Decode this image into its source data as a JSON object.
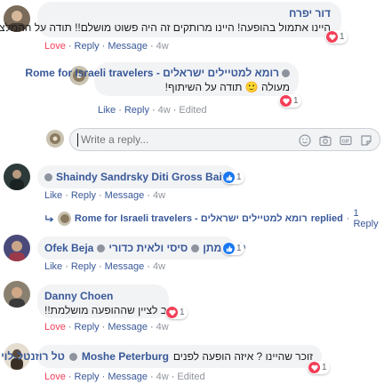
{
  "comments": [
    {
      "author": "דור יפרח",
      "text": "היינו אתמול בהופעה! היינו מרותקים זה היה פשוט מושלם!! תודה על ההמלצה!!",
      "reaction": {
        "type": "love",
        "count": "1"
      },
      "actions": {
        "love": "Love",
        "reply": "Reply",
        "message": "Message",
        "time": "4w"
      },
      "reply": {
        "author": "רומא למטיילים ישראלים - Rome for Israeli travelers",
        "text": "מעולה 🙂 תודה על השיתוף!",
        "reaction": {
          "type": "love",
          "count": "1"
        },
        "actions": {
          "like": "Like",
          "reply": "Reply",
          "time": "4w",
          "edited": "Edited"
        }
      }
    },
    {
      "reply_placeholder": "Write a reply..."
    },
    {
      "author": "Shaindy Sandrsky Diti Gross Baitch",
      "reaction": {
        "type": "like",
        "count": "1"
      },
      "actions": {
        "like": "Like",
        "reply": "Reply",
        "message": "Message",
        "time": "4w"
      },
      "replied_line": {
        "author": "רומא למטיילים ישראלים - Rome for Israeli travelers",
        "replied": "replied",
        "count": "1 Reply"
      }
    },
    {
      "author_rtl": "לילך מתן",
      "author_mid": "סיסי ולאית כדורי",
      "author_ltr": "Ofek Beja",
      "reaction": {
        "type": "like",
        "count": "1"
      },
      "actions": {
        "like": "Like",
        "reply": "Reply",
        "message": "Message",
        "time": "4w"
      }
    },
    {
      "author": "Danny Choen",
      "text": "חייב לציין שההופעה מושלמת!!",
      "reaction": {
        "type": "love",
        "count": "1"
      },
      "actions": {
        "love": "Love",
        "reply": "Reply",
        "message": "Message",
        "time": "4w"
      }
    },
    {
      "author_rtl": "טל רוזנטל-לוי",
      "author_ltr": "Moshe Peterburg",
      "text": "זוכר שהיינו ? איזה הופעה לפנים",
      "reaction": {
        "type": "love",
        "count": "1"
      },
      "actions": {
        "love": "Love",
        "reply": "Reply",
        "message": "Message",
        "time": "4w",
        "edited": "Edited"
      }
    }
  ],
  "colors": {
    "love": "#f33e58",
    "like": "#1877f2",
    "link": "#385898",
    "bubble": "#f2f3f5"
  },
  "icons": [
    "heart-icon",
    "thumbs-up-icon",
    "emoji-icon",
    "camera-icon",
    "gif-icon",
    "sticker-icon",
    "tag-icon",
    "reply-arrow-icon"
  ]
}
